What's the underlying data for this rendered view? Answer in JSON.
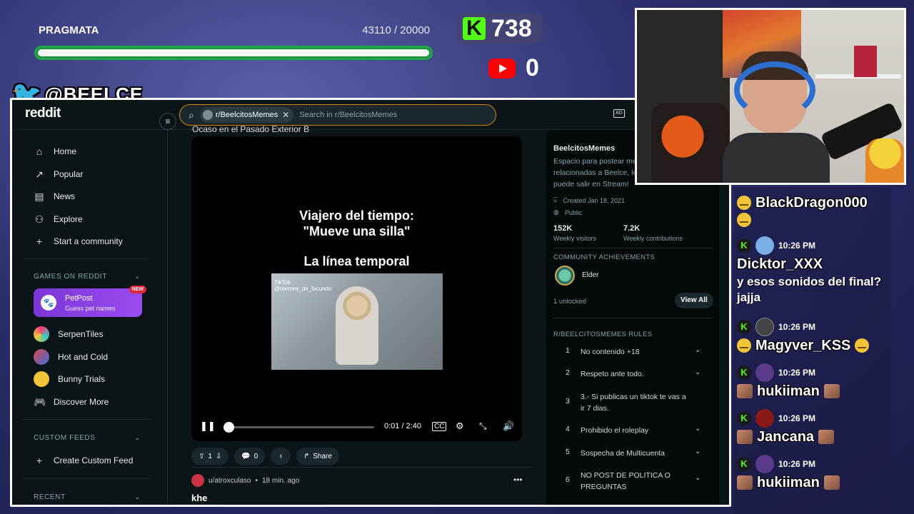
{
  "overlay": {
    "goal_name": "PRAGMATA",
    "goal_count": "43110 / 20000",
    "goal_progress": 1.0,
    "kick_count": "738",
    "youtube_count": "0",
    "twitter_handle": "@BEELCE_"
  },
  "reddit": {
    "logo": "reddit",
    "search_chip": "r/BeelcitosMemes",
    "search_placeholder": "Search in r/BeelcitosMemes",
    "nav": [
      {
        "label": "Home",
        "icon": "home-icon"
      },
      {
        "label": "Popular",
        "icon": "popular-icon"
      },
      {
        "label": "News",
        "icon": "news-icon"
      },
      {
        "label": "Explore",
        "icon": "explore-icon"
      },
      {
        "label": "Start a community",
        "icon": "plus-icon"
      }
    ],
    "games_header": "GAMES ON REDDIT",
    "petpost": {
      "title": "PetPost",
      "subtitle": "Guess pet names",
      "badge": "NEW"
    },
    "games": [
      {
        "label": "SerpenTiles",
        "color": "#ff3b7a"
      },
      {
        "label": "Hot and Cold",
        "color": "#e04848"
      },
      {
        "label": "Bunny Trials",
        "color": "#f2c43a"
      },
      {
        "label": "Discover More",
        "color": ""
      }
    ],
    "custom_feeds_header": "CUSTOM FEEDS",
    "create_custom_feed": "Create Custom Feed",
    "recent_header": "RECENT",
    "post": {
      "title_clip": "Ocaso en el Pasado Exterior B",
      "video_line1": "Viajero del tiempo:",
      "video_line2": "\"Mueve una silla\"",
      "video_line3": "La línea temporal",
      "tiktok_label": "TikTok",
      "tiktok_user": "@memes_de_facundo",
      "time": "0:01 / 2:40",
      "progress": 0.006,
      "vote_count": "1",
      "comment_count": "0",
      "share_label": "Share"
    },
    "next_post": {
      "author": "u/atroxculaso",
      "age": "18 min. ago",
      "title": "khe"
    },
    "sidebar": {
      "name": "BeelcitosMemes",
      "description": "Espacio para postear memes relacionadas a Beelce, lo que puede salir en Stream!",
      "created": "Created Jan 18, 2021",
      "visibility": "Public",
      "visitors_num": "152K",
      "visitors_lbl": "Weekly visitors",
      "contrib_num": "7.2K",
      "contrib_lbl": "Weekly contributions",
      "achievements_header": "COMMUNITY ACHIEVEMENTS",
      "achievement_name": "Elder",
      "unlocked": "1 unlocked",
      "view_all": "View All",
      "rules_header": "R/BEELCITOSMEMES RULES",
      "rules": [
        {
          "n": "1",
          "text": "No contenido +18"
        },
        {
          "n": "2",
          "text": "Respeto ante todo."
        },
        {
          "n": "3",
          "text": "3.- Si publicas un tiktok te vas a ir 7 dias."
        },
        {
          "n": "4",
          "text": "Prohibido el roleplay"
        },
        {
          "n": "5",
          "text": "Sospecha de Multicuenta"
        },
        {
          "n": "6",
          "text": "NO POST DE POLITICA O PREGUNTAS"
        }
      ]
    }
  },
  "chat": {
    "top_user": "BlackDragon000",
    "messages": [
      {
        "time": "10:26 PM",
        "user": "Dicktor_XXX",
        "text": "y esos sonidos del final? jajja",
        "avatar_color": "#7ab0e8"
      },
      {
        "time": "10:26 PM",
        "user": "Magyver_KSS",
        "text": "",
        "avatar_color": "#444444"
      },
      {
        "time": "10:26 PM",
        "user": "hukiiman",
        "text": "",
        "avatar_color": "#5a3a8a"
      },
      {
        "time": "10:26 PM",
        "user": "Jancana",
        "text": "",
        "avatar_color": "#8a1a1a"
      },
      {
        "time": "10:26 PM",
        "user": "hukiiman",
        "text": "",
        "avatar_color": "#5a3a8a"
      }
    ]
  }
}
